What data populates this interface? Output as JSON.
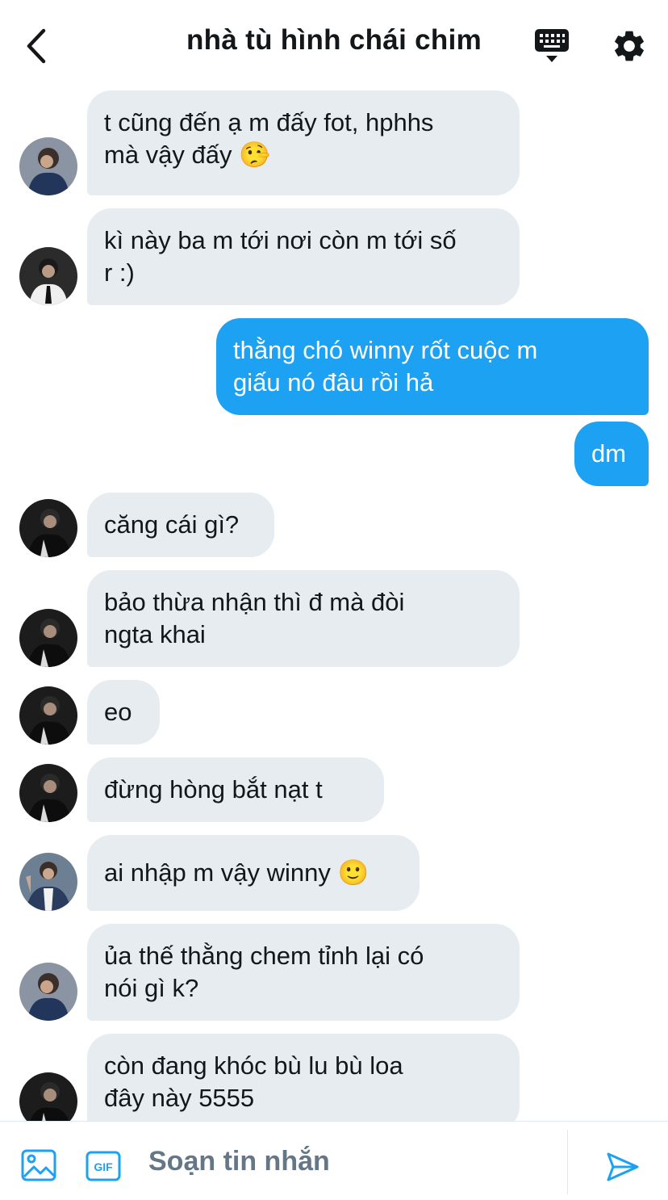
{
  "header": {
    "title": "nhà tù hình chái chim"
  },
  "messages": [
    {
      "side": "in",
      "avatar": "a",
      "text": "t cũng đến ạ m đấy fot, hphhs\nmà vậy đấy 🤥"
    },
    {
      "side": "in",
      "avatar": "b",
      "text": "kì này ba m tới nơi còn m tới số\nr :)"
    },
    {
      "side": "out",
      "text": "thằng chó winny rốt cuộc m\ngiấu nó đâu rồi hả"
    },
    {
      "side": "out",
      "text": "dm"
    },
    {
      "side": "in",
      "avatar": "c",
      "text": "căng cái gì?"
    },
    {
      "side": "in",
      "avatar": "c",
      "text": "bảo thừa nhận thì đ mà đòi\nngta khai"
    },
    {
      "side": "in",
      "avatar": "c",
      "text": "eo"
    },
    {
      "side": "in",
      "avatar": "c",
      "text": "đừng hòng bắt nạt t"
    },
    {
      "side": "in",
      "avatar": "d",
      "text": "ai nhập m vậy winny 🙂"
    },
    {
      "side": "in",
      "avatar": "a",
      "text": "ủa thế thằng chem tỉnh lại có\nnói gì k?"
    },
    {
      "side": "in",
      "avatar": "c",
      "text": "còn đang khóc bù lu bù loa\nđây này 5555"
    }
  ],
  "composer": {
    "placeholder": "Soạn tin nhắn",
    "gif_label": "GIF"
  },
  "colors": {
    "accent": "#1da1f2",
    "incoming_bubble": "#e6ecf0",
    "placeholder": "#657786"
  },
  "icons": {
    "back": "chevron-left-icon",
    "keyboard": "keyboard-icon",
    "settings": "gear-icon",
    "image": "image-icon",
    "gif": "gif-icon",
    "send": "send-icon"
  }
}
